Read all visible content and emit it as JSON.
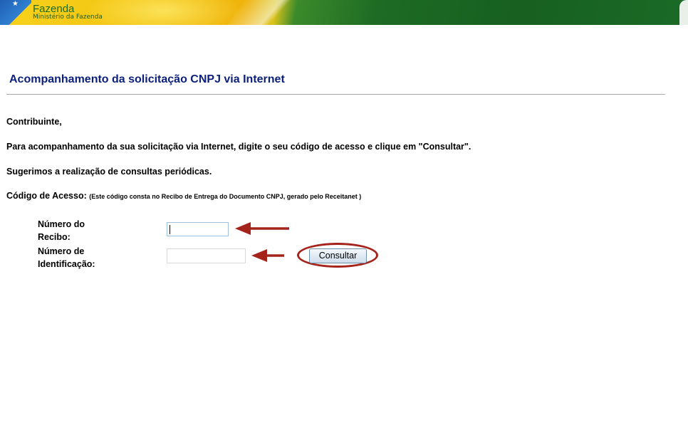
{
  "header": {
    "brand": "Fazenda",
    "subtitle": "Ministério da Fazenda"
  },
  "page": {
    "title": "Acompanhamento da solicitação CNPJ via Internet"
  },
  "content": {
    "greeting": "Contribuinte,",
    "instruction": "Para acompanhamento da sua solicitação via Internet, digite o seu código de acesso e clique em \"Consultar\".",
    "suggestion": "Sugerimos a realização de consultas periódicas.",
    "access_code_label": "Código de Acesso:",
    "access_code_note": "(Este código consta no Recibo de Entrega do Documento CNPJ, gerado pelo Receitanet )"
  },
  "form": {
    "receipt_label_line1": "Número do",
    "receipt_label_line2": "Recibo:",
    "receipt_value": "",
    "id_label_line1": "Número de",
    "id_label_line2": "Identificação:",
    "id_value": "",
    "submit_label": "Consultar"
  },
  "annotations": {
    "arrow_color": "#a4241c",
    "ring_color": "#a4241c"
  },
  "colors": {
    "title": "#0b1f7c",
    "banner_green": "#1b6b26",
    "banner_yellow": "#f3c312"
  }
}
